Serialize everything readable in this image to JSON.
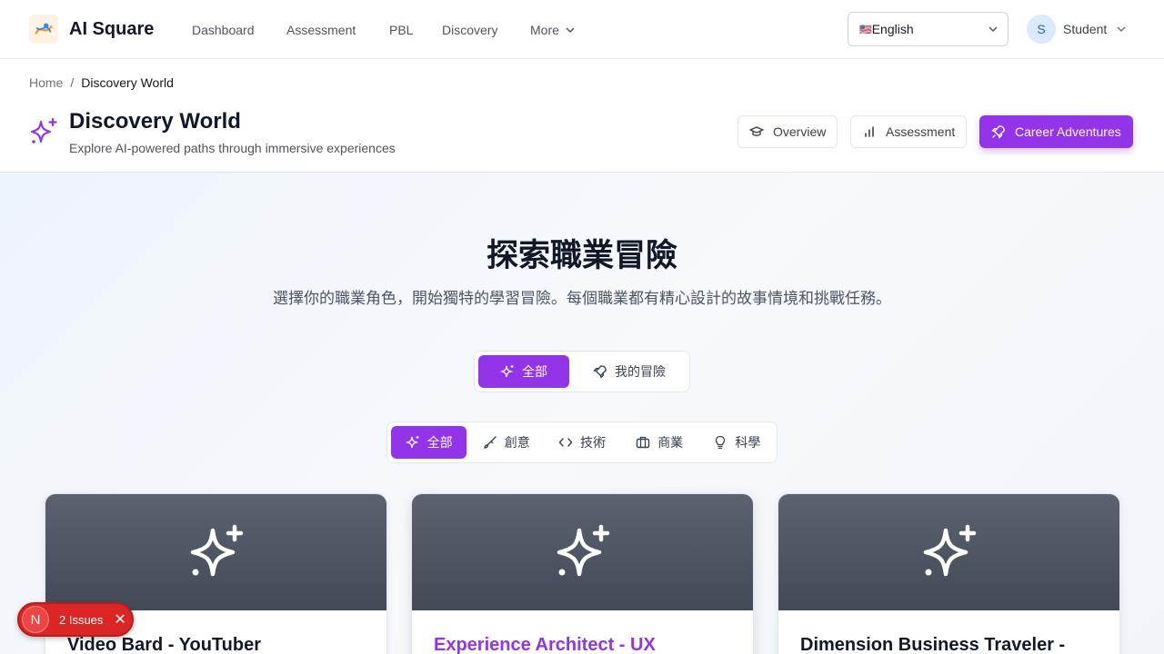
{
  "app": {
    "name": "AI Square",
    "nav": [
      "Dashboard",
      "Assessment",
      "PBL",
      "Discovery",
      "More"
    ],
    "language": {
      "flag": "🇺🇸",
      "selected": "English"
    },
    "user": {
      "initial": "S",
      "name": "Student"
    }
  },
  "breadcrumb": {
    "home": "Home",
    "separator": "/",
    "current": "Discovery World"
  },
  "header": {
    "title": "Discovery World",
    "subtitle": "Explore AI-powered paths through immersive experiences",
    "buttons": [
      {
        "label": "Overview",
        "icon": "graduation-cap-icon"
      },
      {
        "label": "Assessment",
        "icon": "bar-chart-icon"
      },
      {
        "label": "Career Adventures",
        "icon": "rocket-icon",
        "active": true
      }
    ]
  },
  "hero": {
    "title": "探索職業冒險",
    "subtitle": "選擇你的職業角色，開始獨特的學習冒險。每個職業都有精心設計的故事情境和挑戰任務。"
  },
  "view_tabs": [
    {
      "label": "全部",
      "icon": "sparkles-icon",
      "active": true
    },
    {
      "label": "我的冒險",
      "icon": "rocket-icon",
      "active": false
    }
  ],
  "category_tabs": [
    {
      "label": "全部",
      "icon": "sparkles-icon",
      "active": true
    },
    {
      "label": "創意",
      "icon": "brush-icon",
      "active": false
    },
    {
      "label": "技術",
      "icon": "code-icon",
      "active": false
    },
    {
      "label": "商業",
      "icon": "briefcase-icon",
      "active": false
    },
    {
      "label": "科學",
      "icon": "lightbulb-icon",
      "active": false
    }
  ],
  "cards": [
    {
      "title": "Video Bard - YouTuber",
      "highlight": false
    },
    {
      "title": "Experience Architect - UX",
      "highlight": true
    },
    {
      "title": "Dimension Business Traveler -",
      "highlight": false
    }
  ],
  "issues": {
    "badge": "N",
    "label": "2 Issues"
  },
  "colors": {
    "accent": "#9333ea",
    "danger": "#dc2626",
    "banner": "#4b5260"
  }
}
